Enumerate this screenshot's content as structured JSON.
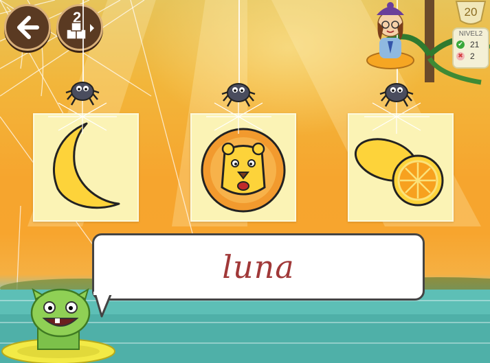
{
  "toolbar": {
    "back_icon": "arrow-left-icon",
    "cube_icon": "cubes-icon",
    "activity_number": "2"
  },
  "score": {
    "trophy_points": "20",
    "level_label": "NIVEL2",
    "correct_count": "21",
    "wrong_count": "2"
  },
  "cards": [
    {
      "name": "moon",
      "icon": "moon-icon"
    },
    {
      "name": "lion",
      "icon": "lion-icon"
    },
    {
      "name": "lemon",
      "icon": "lemon-icon"
    }
  ],
  "speech": {
    "word": "luna"
  },
  "colors": {
    "accent_yellow": "#fdd33a",
    "correct_green": "#3aa83a",
    "wrong_red": "#d23b3b",
    "word_red": "#a03838"
  }
}
